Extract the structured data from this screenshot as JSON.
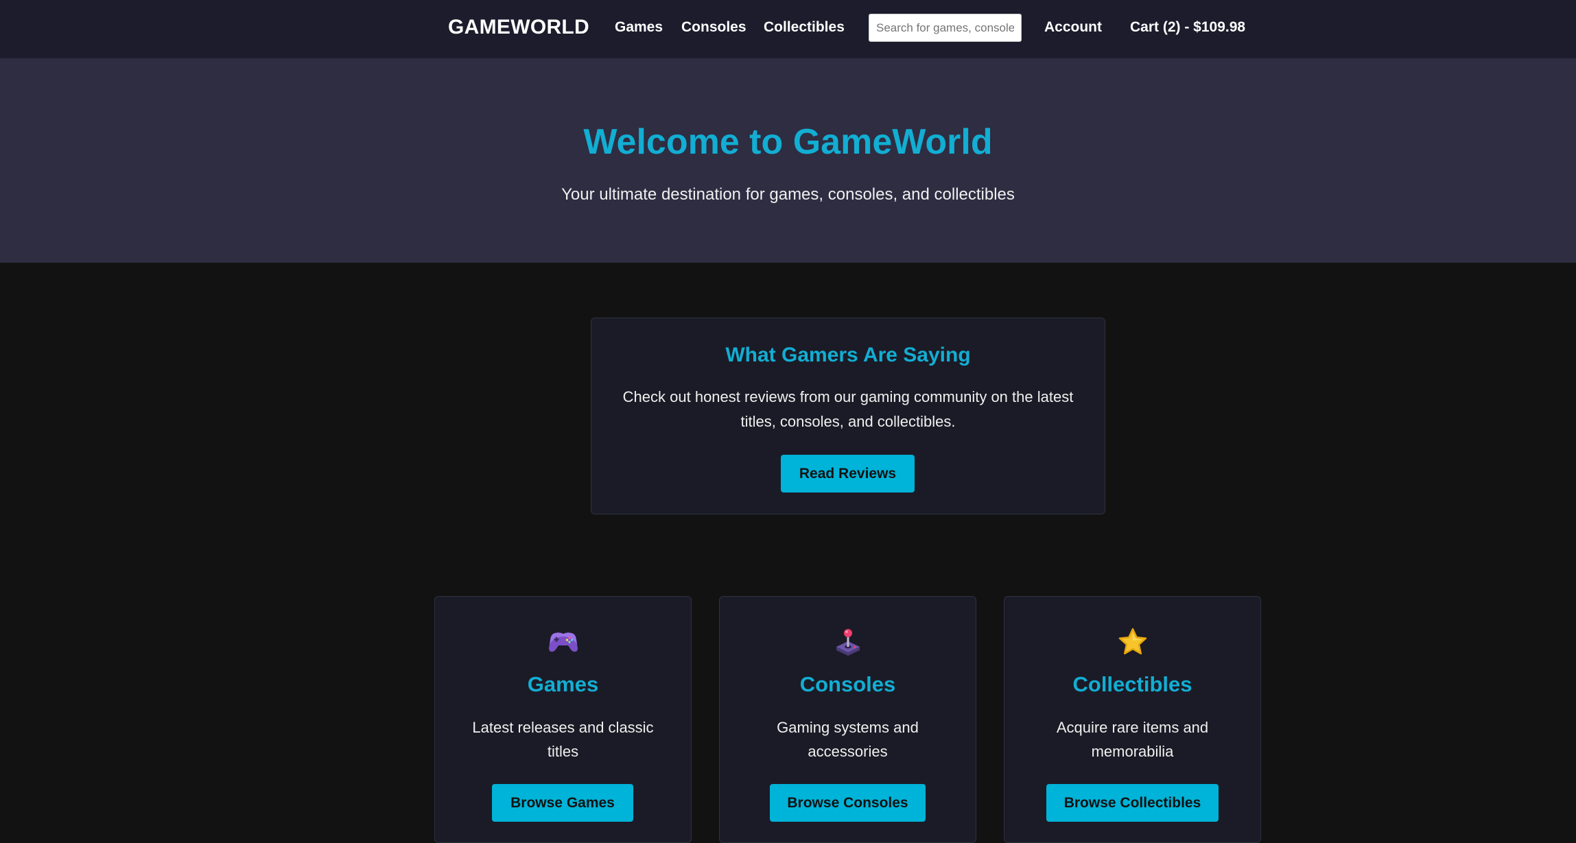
{
  "header": {
    "logo": "GAMEWORLD",
    "nav": [
      {
        "label": "Games"
      },
      {
        "label": "Consoles"
      },
      {
        "label": "Collectibles"
      }
    ],
    "search_placeholder": "Search for games, consoles...",
    "search_value": "",
    "account_label": "Account",
    "cart_label": "Cart (2) - $109.98"
  },
  "hero": {
    "title": "Welcome to GameWorld",
    "subtitle": "Your ultimate destination for games, consoles, and collectibles"
  },
  "reviews": {
    "title": "What Gamers Are Saying",
    "text": "Check out honest reviews from our gaming community on the latest titles, consoles, and collectibles.",
    "button_label": "Read Reviews"
  },
  "categories": [
    {
      "icon": "gamepad-icon",
      "title": "Games",
      "description": "Latest releases and classic titles",
      "button_label": "Browse Games"
    },
    {
      "icon": "joystick-icon",
      "title": "Consoles",
      "description": "Gaming systems and accessories",
      "button_label": "Browse Consoles"
    },
    {
      "icon": "star-icon",
      "title": "Collectibles",
      "description": "Acquire rare items and memorabilia",
      "button_label": "Browse Collectibles"
    }
  ],
  "colors": {
    "accent": "#12aed3",
    "button": "#00b3d8",
    "header_bg": "#1c1c2c",
    "hero_bg": "#2e2d42",
    "page_bg": "#121212",
    "card_bg": "#1b1b27"
  }
}
